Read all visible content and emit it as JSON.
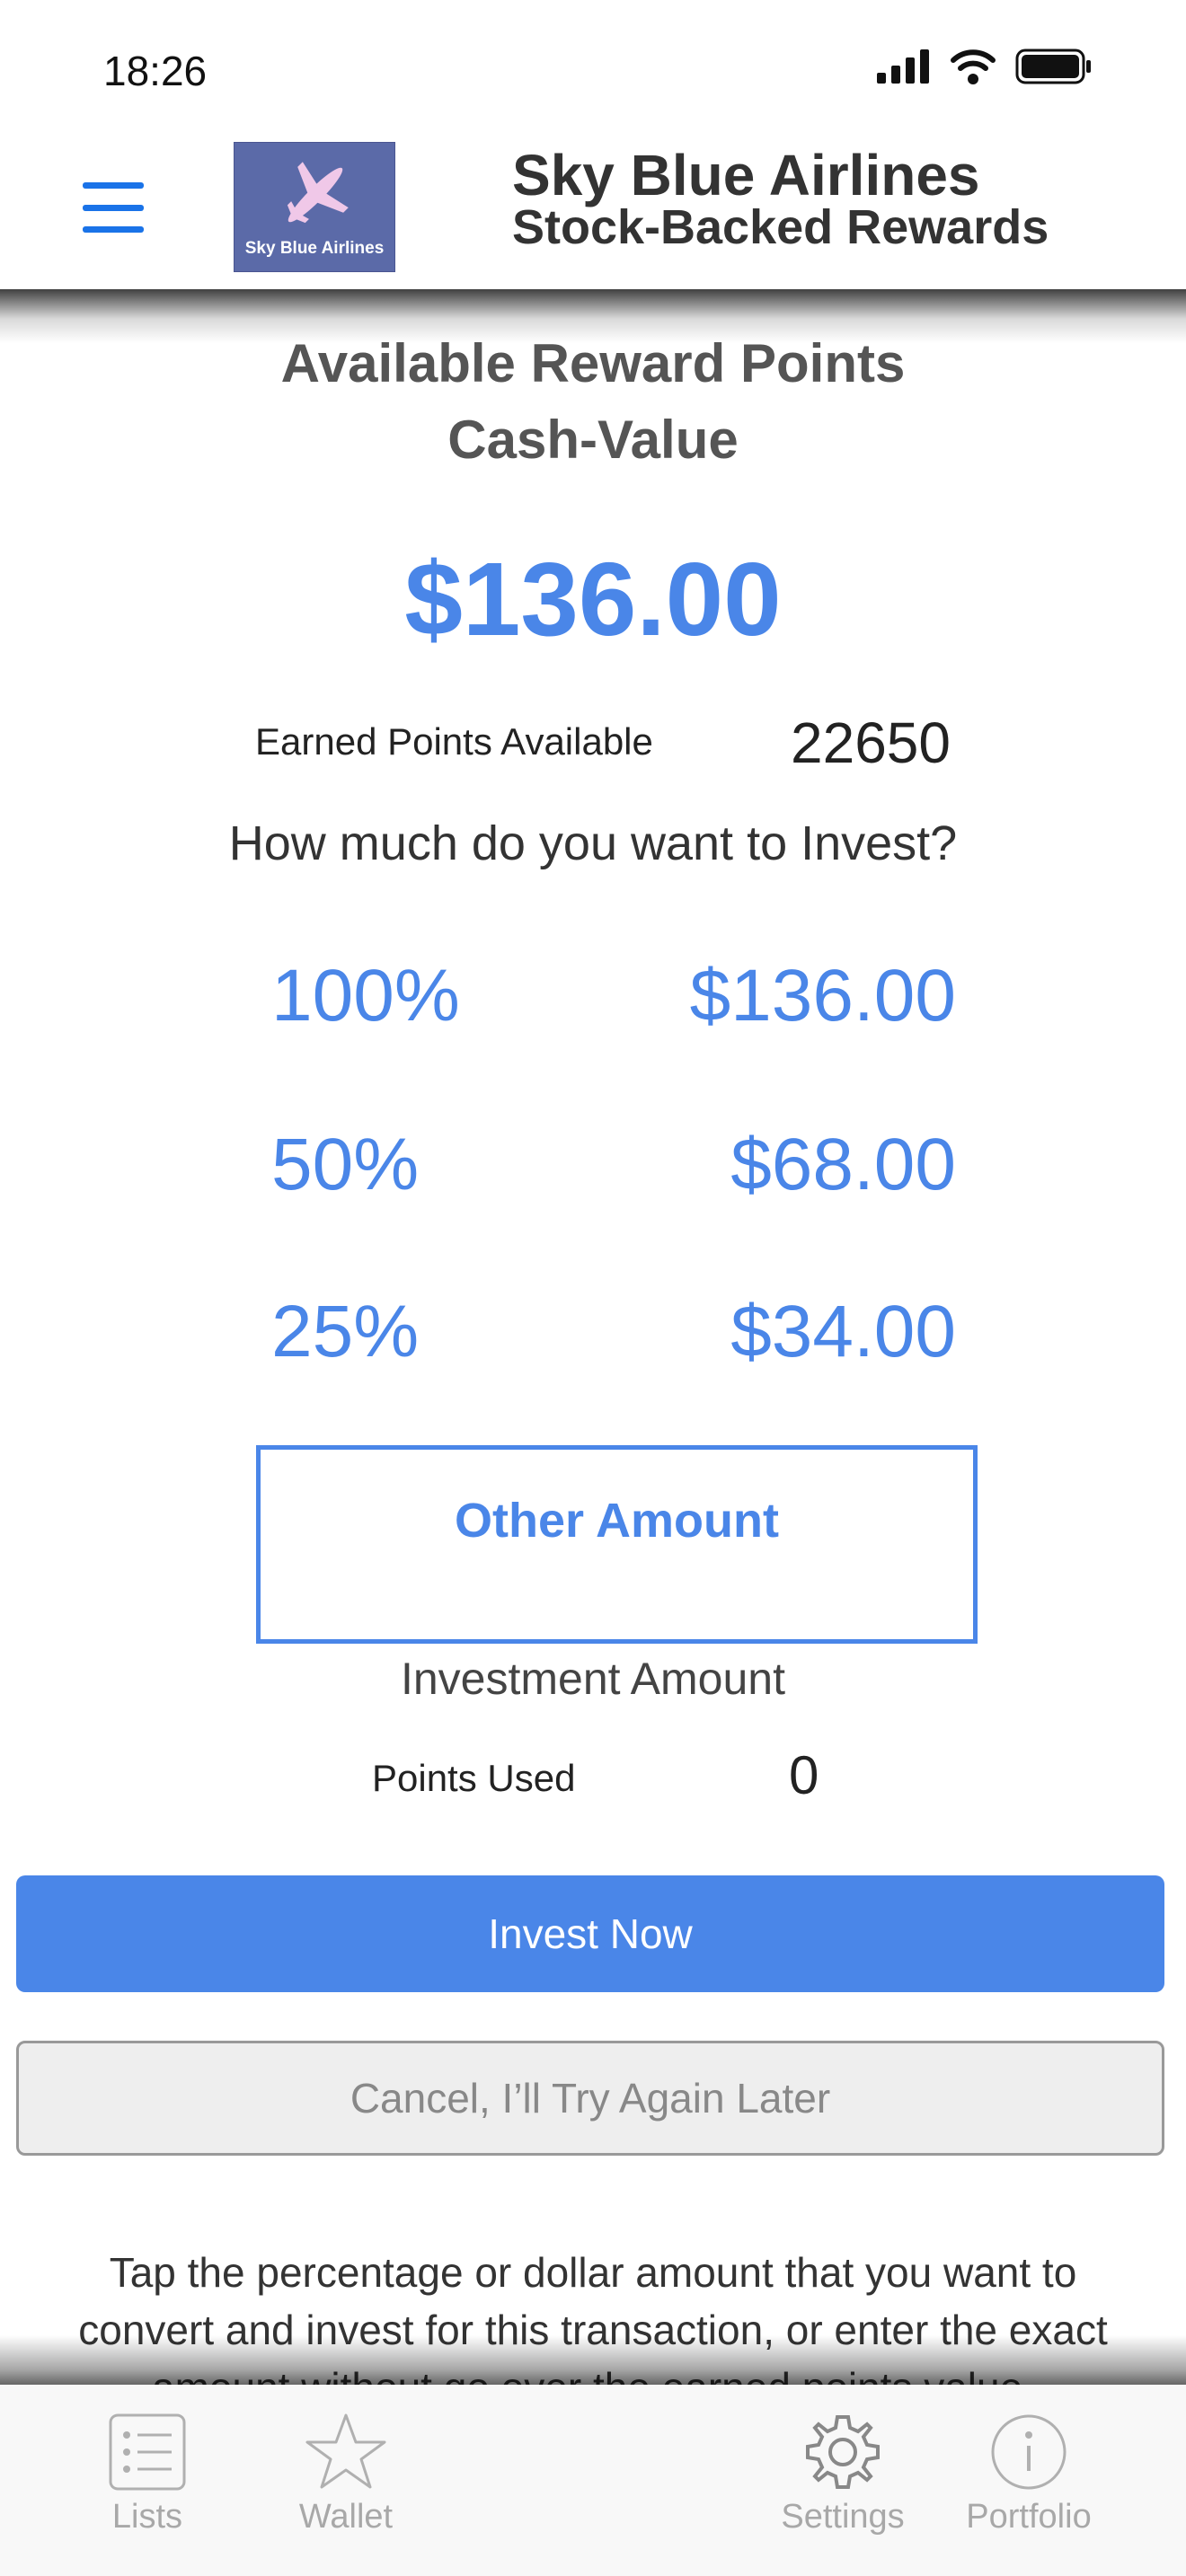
{
  "status_bar": {
    "time": "18:26"
  },
  "header": {
    "logo_text": "Sky Blue Airlines",
    "title": "Sky Blue Airlines",
    "subtitle": "Stock-Backed Rewards"
  },
  "main": {
    "heading_line1": "Available Reward Points",
    "heading_line2": "Cash-Value",
    "cash_value": "$136.00",
    "earned_points_label": "Earned Points Available",
    "earned_points_value": "22650",
    "question": "How much do you want to Invest?",
    "options": [
      {
        "percent": "100%",
        "amount": "$136.00"
      },
      {
        "percent": "50%",
        "amount": "$68.00"
      },
      {
        "percent": "25%",
        "amount": "$34.00"
      }
    ],
    "other_amount_label": "Other Amount",
    "investment_amount_label": "Investment Amount",
    "points_used_label": "Points Used",
    "points_used_value": "0",
    "invest_button": "Invest Now",
    "cancel_button": "Cancel, I’ll Try Again Later",
    "instructions": "Tap the percentage or dollar amount that you want to convert and invest for this transaction, or enter the exact amount without go over the earned points value."
  },
  "tabbar": {
    "items": [
      {
        "label": "Lists",
        "icon": "list-icon"
      },
      {
        "label": "Wallet",
        "icon": "star-icon"
      },
      {
        "label": "Settings",
        "icon": "gear-icon"
      },
      {
        "label": "Portfolio",
        "icon": "info-icon"
      }
    ]
  },
  "colors": {
    "accent": "#4a86e8",
    "menu": "#1a73e8",
    "logo_bg": "#5b6aa8"
  }
}
